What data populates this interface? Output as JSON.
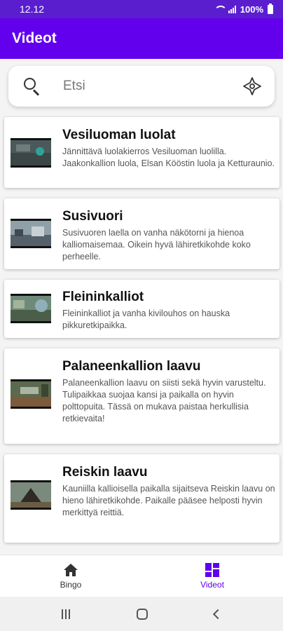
{
  "status_bar": {
    "time": "12.12",
    "battery": "100%"
  },
  "app_bar": {
    "title": "Videot"
  },
  "search": {
    "placeholder": "Etsi",
    "value": ""
  },
  "videos": [
    {
      "title": "Vesiluoman luolat",
      "description": "Jännittävä luolakierros Vesiluoman luolilla. Jaakonkallion luola, Elsan Kööstin luola ja Ketturaunio."
    },
    {
      "title": "Susivuori",
      "description": "Susivuoren laella on vanha näkötorni ja hienoa kalliomaisemaa. Oikein hyvä lähiretkikohde koko perheelle."
    },
    {
      "title": "Fleininkalliot",
      "description": "Fleininkalliot ja vanha kivilouhos on hauska pikkuretkipaikka."
    },
    {
      "title": "Palaneenkallion laavu",
      "description": "Palaneenkallion laavu on siisti sekä hyvin varusteltu. Tulipaikkaa suojaa kansi ja paikalla on hyvin polttopuita. Tässä on mukava paistaa herkullisia retkievaita!"
    },
    {
      "title": "Reiskin laavu",
      "description": "Kauniilla kallioisella paikalla sijaitseva Reiskin laavu on hieno lähiretkikohde. Paikalle pääsee helposti hyvin merkittyä reittiä."
    }
  ],
  "bottom_nav": {
    "items": [
      {
        "label": "Bingo",
        "icon": "home-icon",
        "active": false
      },
      {
        "label": "Videot",
        "icon": "dashboard-icon",
        "active": true
      }
    ]
  },
  "colors": {
    "primary": "#6200ee",
    "status_bar": "#5a1ecf"
  }
}
